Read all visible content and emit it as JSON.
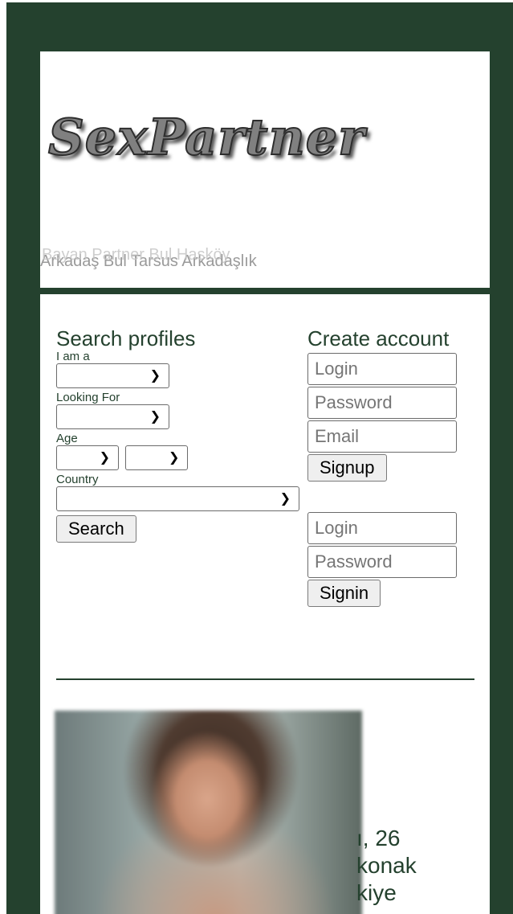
{
  "header": {
    "logo_text": "SexPartner",
    "tagline_a": "Arkadaş Bul Tarsus Arkadaşlık",
    "tagline_b": "Bayan Partner Bul Hasköy"
  },
  "search": {
    "title": "Search profiles",
    "i_am_label": "I am a",
    "looking_for_label": "Looking For",
    "age_label": "Age",
    "country_label": "Country",
    "i_am_value": "",
    "looking_for_value": "",
    "age_min_value": "",
    "age_max_value": "",
    "country_value": "",
    "search_button": "Search"
  },
  "signup": {
    "title": "Create account",
    "login_placeholder": "Login",
    "password_placeholder": "Password",
    "email_placeholder": "Email",
    "signup_button": "Signup"
  },
  "signin": {
    "login_placeholder": "Login",
    "password_placeholder": "Password",
    "signin_button": "Signin"
  },
  "profile": {
    "line1": "ı, 26",
    "line2": "konak",
    "line3": "kiye"
  },
  "colors": {
    "frame_bg": "#24412e",
    "panel_bg": "#ffffff",
    "text_accent": "#24412e"
  },
  "icons": {
    "select_arrow": "chevron-down-icon"
  }
}
